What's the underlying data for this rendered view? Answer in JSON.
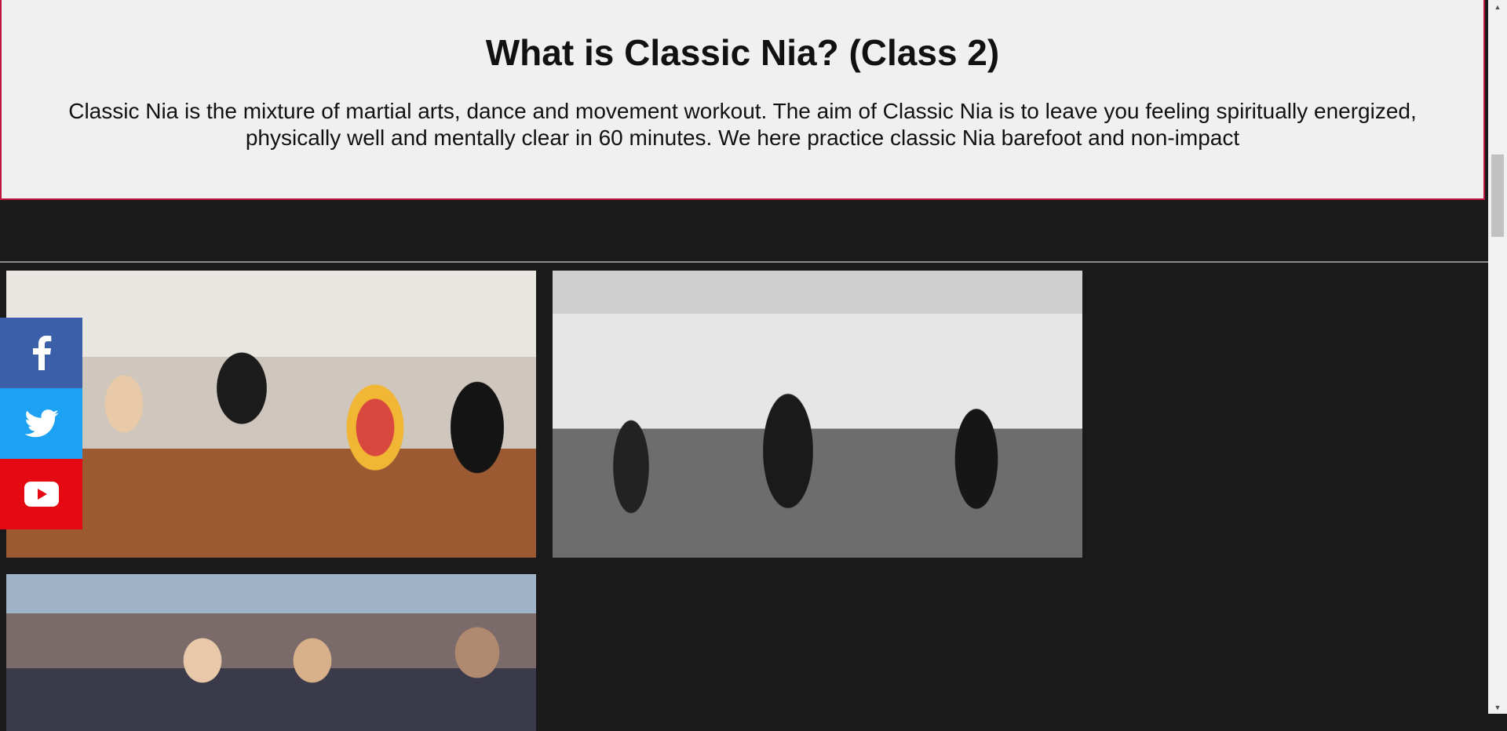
{
  "intro": {
    "title": "What is Classic Nia? (Class 2)",
    "description": "Classic Nia is the mixture of martial arts, dance and movement workout. The aim of Classic Nia is to leave you feeling spiritually energized, physically well and mentally clear in 60 minutes. We here practice classic Nia barefoot and non-impact"
  },
  "social": {
    "facebook_icon": "facebook-icon",
    "twitter_icon": "twitter-icon",
    "youtube_icon": "youtube-icon",
    "facebook_color": "#3b5fa8",
    "twitter_color": "#1da1f2",
    "youtube_color": "#e50914"
  },
  "colors": {
    "page_background": "#1a1a1a",
    "intro_background": "#f0f0f0",
    "intro_border": "#c0143c"
  }
}
